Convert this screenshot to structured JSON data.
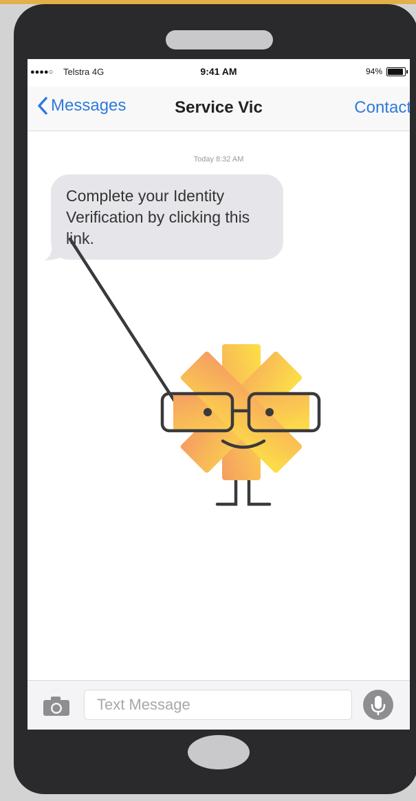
{
  "status_bar": {
    "signal": "●●●●○",
    "carrier": "Telstra  4G",
    "time": "9:41 AM",
    "battery_text": "94%",
    "battery_level": 0.94
  },
  "nav": {
    "back_label": "Messages",
    "title": "Service Vic",
    "contact_label": "Contact"
  },
  "conversation": {
    "timestamp": "Today 8:32 AM",
    "message": "Complete your Identity Verification by clicking this link."
  },
  "composer": {
    "placeholder": "Text Message"
  },
  "colors": {
    "accent": "#2f7ad8",
    "bubble": "#e6e6ea",
    "mascot_gradient_start": "#f59e62",
    "mascot_gradient_end": "#fde047",
    "phone_body": "#2a2a2c"
  },
  "icons": {
    "back": "chevron-left-icon",
    "camera": "camera-icon",
    "mic": "microphone-icon"
  }
}
